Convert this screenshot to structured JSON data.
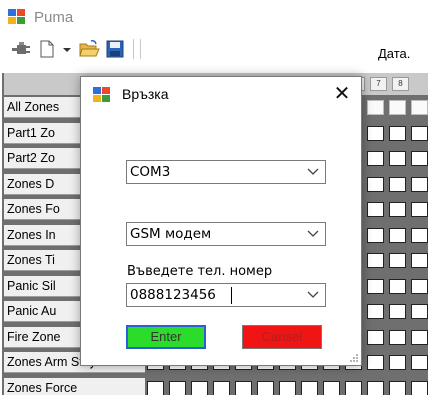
{
  "app": {
    "title": "Puma",
    "header_label": "Дата."
  },
  "grid": {
    "column_headers": [
      "7",
      "8"
    ],
    "rows": [
      "All Zones",
      "Part1 Zo",
      "Part2 Zo",
      "Zones D",
      "Zones Fo",
      "Zones In",
      "Zones Ti",
      "Panic Sil",
      "Panic Au",
      "Fire Zone",
      "Zones Arm Stay",
      "Zones Force"
    ]
  },
  "dialog": {
    "title": "Връзка",
    "port": {
      "value": "COM3"
    },
    "device": {
      "value": "GSM модем"
    },
    "phone": {
      "label": "Въведете тел. номер",
      "value": "0888123456"
    },
    "enter_label": "Enter",
    "cancel_label": "Cansel"
  },
  "colors": {
    "enter_button": "#2bdc2b",
    "cancel_button": "#f01414",
    "focus_border": "#2b5fd9"
  },
  "icons": [
    "plug-icon",
    "new-document-icon",
    "open-folder-icon",
    "save-icon",
    "close-icon",
    "chevron-down-icon"
  ]
}
